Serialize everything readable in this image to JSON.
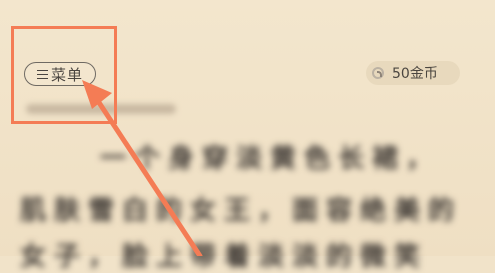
{
  "header": {
    "menu_label": "菜单",
    "coins_label": "50金币"
  },
  "content": {
    "line1": "一个身穿淡黄色长裙，",
    "line2": "肌肤雪白的女王，面容绝美的",
    "line3": "女子，脸上带着淡淡的微笑"
  },
  "colors": {
    "highlight": "#f47c55",
    "background": "#f1e3c9"
  }
}
